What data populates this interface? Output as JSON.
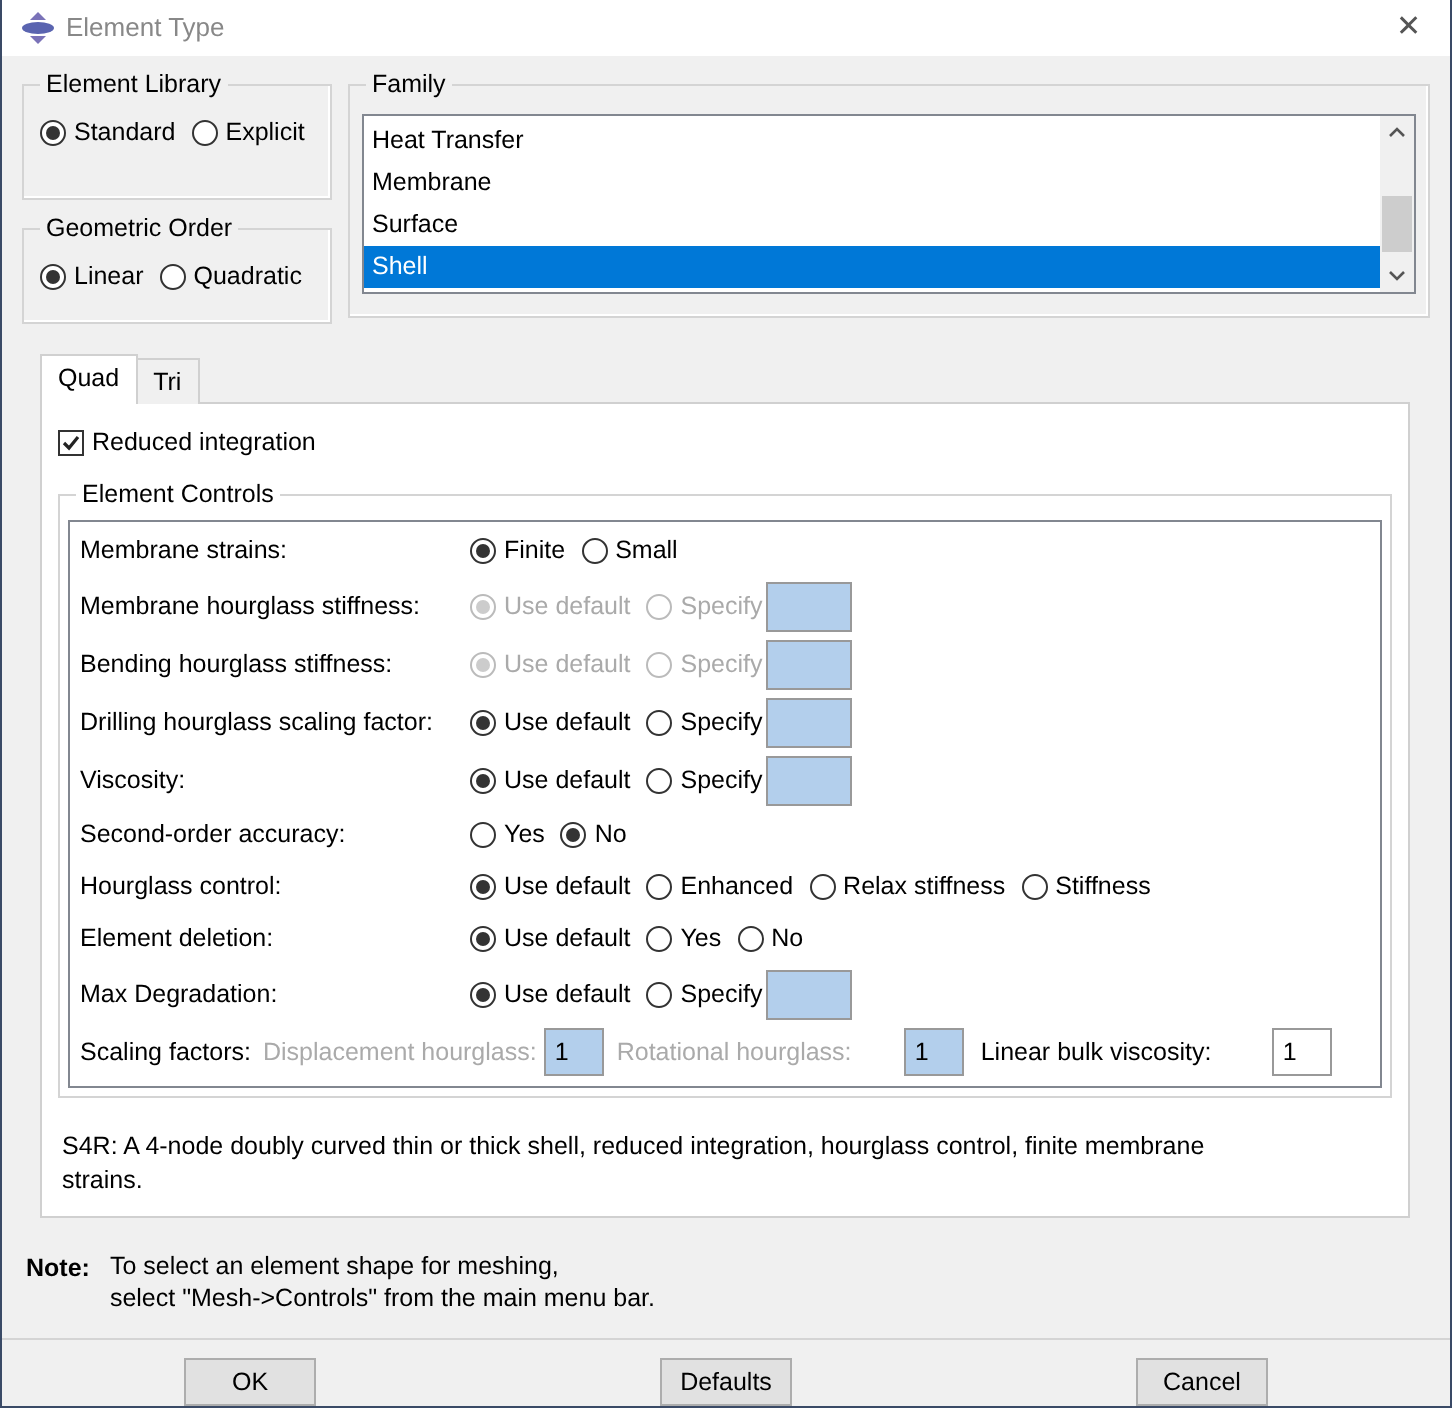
{
  "window": {
    "title": "Element Type",
    "close": "✕"
  },
  "element_library": {
    "title": "Element Library",
    "options": [
      {
        "label": "Standard",
        "selected": true
      },
      {
        "label": "Explicit",
        "selected": false
      }
    ]
  },
  "geometric_order": {
    "title": "Geometric Order",
    "options": [
      {
        "label": "Linear",
        "selected": true
      },
      {
        "label": "Quadratic",
        "selected": false
      }
    ]
  },
  "family": {
    "title": "Family",
    "items": [
      {
        "label": "Heat Transfer",
        "selected": false
      },
      {
        "label": "Membrane",
        "selected": false
      },
      {
        "label": "Surface",
        "selected": false
      },
      {
        "label": "Shell",
        "selected": true
      }
    ]
  },
  "tabs": [
    {
      "label": "Quad",
      "selected": true
    },
    {
      "label": "Tri",
      "selected": false
    }
  ],
  "reduced_integration": {
    "label": "Reduced integration",
    "checked": true
  },
  "element_controls": {
    "title": "Element Controls",
    "rows": [
      {
        "kind": "radios",
        "label": "Membrane strains:",
        "disabled": false,
        "options": [
          {
            "label": "Finite",
            "selected": true
          },
          {
            "label": "Small",
            "selected": false
          }
        ]
      },
      {
        "kind": "radios_field",
        "label": "Membrane hourglass stiffness:",
        "disabled": true,
        "options": [
          {
            "label": "Use default",
            "selected": true
          },
          {
            "label": "Specify",
            "selected": false
          }
        ]
      },
      {
        "kind": "radios_field",
        "label": "Bending hourglass stiffness:",
        "disabled": true,
        "options": [
          {
            "label": "Use default",
            "selected": true
          },
          {
            "label": "Specify",
            "selected": false
          }
        ]
      },
      {
        "kind": "radios_field",
        "label": "Drilling hourglass scaling factor:",
        "disabled": false,
        "options": [
          {
            "label": "Use default",
            "selected": true
          },
          {
            "label": "Specify",
            "selected": false
          }
        ]
      },
      {
        "kind": "radios_field",
        "label": "Viscosity:",
        "disabled": false,
        "options": [
          {
            "label": "Use default",
            "selected": true
          },
          {
            "label": "Specify",
            "selected": false
          }
        ]
      },
      {
        "kind": "radios",
        "label": "Second-order accuracy:",
        "disabled": false,
        "options": [
          {
            "label": "Yes",
            "selected": false
          },
          {
            "label": "No",
            "selected": true
          }
        ]
      },
      {
        "kind": "radios",
        "label": "Hourglass control:",
        "disabled": false,
        "options": [
          {
            "label": "Use default",
            "selected": true
          },
          {
            "label": "Enhanced",
            "selected": false
          },
          {
            "label": "Relax stiffness",
            "selected": false
          },
          {
            "label": "Stiffness",
            "selected": false
          }
        ]
      },
      {
        "kind": "radios",
        "label": "Element deletion:",
        "disabled": false,
        "options": [
          {
            "label": "Use default",
            "selected": true
          },
          {
            "label": "Yes",
            "selected": false
          },
          {
            "label": "No",
            "selected": false
          }
        ]
      },
      {
        "kind": "radios_field",
        "label": "Max Degradation:",
        "disabled": false,
        "options": [
          {
            "label": "Use default",
            "selected": true
          },
          {
            "label": "Specify",
            "selected": false
          }
        ]
      }
    ],
    "scaling": {
      "label": "Scaling factors:",
      "items": [
        {
          "label": "Displacement hourglass:",
          "value": "1",
          "disabled": true
        },
        {
          "label": "Rotational hourglass:",
          "value": "1",
          "disabled": true
        },
        {
          "label": "Linear bulk viscosity:",
          "value": "1",
          "disabled": false
        }
      ]
    }
  },
  "description": "S4R:  A 4-node doubly curved thin or thick shell, reduced integration, hourglass control, finite membrane strains.",
  "note": {
    "label": "Note:",
    "lines": [
      "To select an element shape for meshing,",
      "select \"Mesh->Controls\" from the main menu bar."
    ]
  },
  "buttons": [
    "OK",
    "Defaults",
    "Cancel"
  ]
}
